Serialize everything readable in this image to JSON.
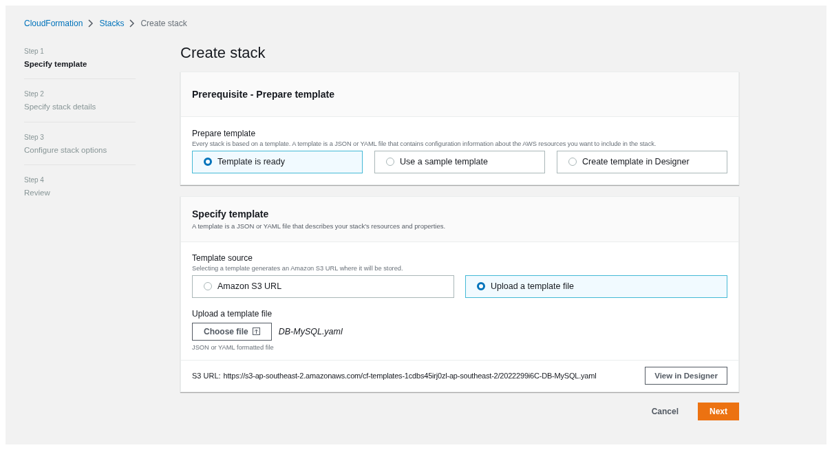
{
  "breadcrumbs": [
    {
      "label": "CloudFormation",
      "link": true
    },
    {
      "label": "Stacks",
      "link": true
    },
    {
      "label": "Create stack",
      "link": false
    }
  ],
  "steps": [
    {
      "step": "Step 1",
      "label": "Specify template",
      "selected": true
    },
    {
      "step": "Step 2",
      "label": "Specify stack details",
      "selected": false
    },
    {
      "step": "Step 3",
      "label": "Configure stack options",
      "selected": false
    },
    {
      "step": "Step 4",
      "label": "Review",
      "selected": false
    }
  ],
  "title": "Create stack",
  "prerequisite": {
    "heading": "Prerequisite - Prepare template",
    "field_label": "Prepare template",
    "description": "Every stack is based on a template. A template is a JSON or YAML file that contains configuration information about the AWS resources you want to include in the stack.",
    "options": [
      {
        "label": "Template is ready",
        "selected": true
      },
      {
        "label": "Use a sample template",
        "selected": false
      },
      {
        "label": "Create template in Designer",
        "selected": false
      }
    ]
  },
  "specify": {
    "heading": "Specify template",
    "description": "A template is a JSON or YAML file that describes your stack's resources and properties.",
    "field_label": "Template source",
    "field_description": "Selecting a template generates an Amazon S3 URL where it will be stored.",
    "options": [
      {
        "label": "Amazon S3 URL",
        "selected": false
      },
      {
        "label": "Upload a template file",
        "selected": true
      }
    ],
    "upload_label": "Upload a template file",
    "choose_button": "Choose file",
    "file_name": "DB-MySQL.yaml",
    "upload_hint": "JSON or YAML formatted file",
    "s3_label": "S3 URL:",
    "s3_url": "https://s3-ap-southeast-2.amazonaws.com/cf-templates-1cdbs45irj0zl-ap-southeast-2/2022299i6C-DB-MySQL.yaml",
    "designer_button": "View in Designer"
  },
  "actions": {
    "cancel": "Cancel",
    "next": "Next"
  }
}
